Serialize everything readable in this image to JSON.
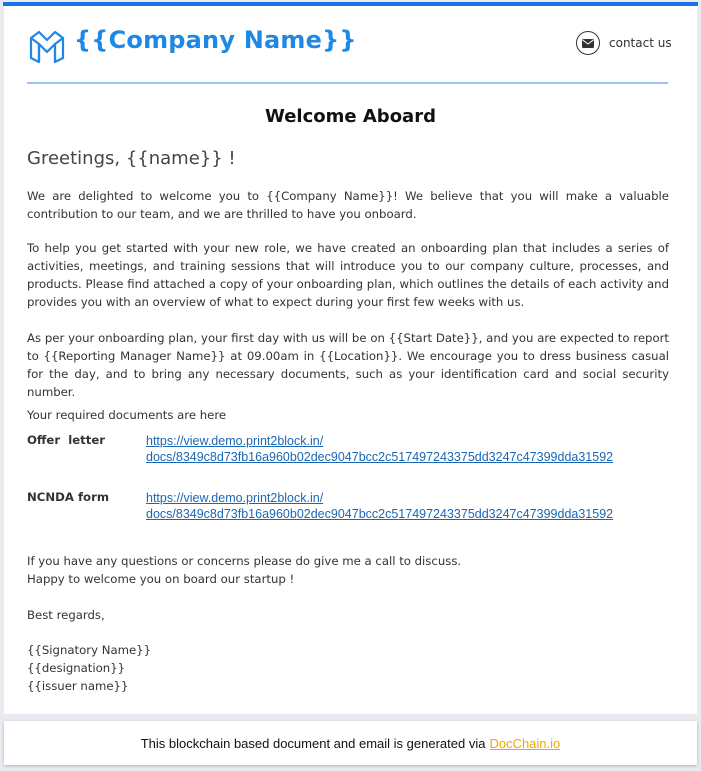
{
  "header": {
    "company_name": "{{Company Name}}",
    "contact_label": "contact us",
    "brand_color": "#1e88e5"
  },
  "title": "Welcome Aboard",
  "greeting": "Greetings,  {{name}} !",
  "body": {
    "p1": "We are delighted to welcome you to {{Company Name}}! We believe that you will make a valuable contribution to our team, and we are thrilled to have you onboard.",
    "p2": "To help you get started with your new role, we have created an onboarding plan that includes a series of activities, meetings, and training sessions that will introduce you to our company culture, processes, and products. Please find attached a copy of your onboarding plan, which outlines the details of each activity and provides you with an overview of what to expect during your first few weeks with us.",
    "p3": "As per your onboarding plan, your first day with us will be on {{Start Date}}, and you are expected to report to {{Reporting Manager Name}} at 09.00am in {{Location}}. We encourage you to dress business casual for the day, and to bring any necessary documents, such as your identification card and social security number."
  },
  "documents": {
    "intro": "Your required documents are here",
    "items": [
      {
        "label": "Offer  letter",
        "link_line1": "https://view.demo.print2block.in/",
        "link_line2": "docs/8349c8d73fb16a960b02dec9047bcc2c517497243375dd3247c47399dda31592"
      },
      {
        "label": "NCNDA form",
        "link_line1": "https://view.demo.print2block.in/",
        "link_line2": "docs/8349c8d73fb16a960b02dec9047bcc2c517497243375dd3247c47399dda31592"
      }
    ]
  },
  "closing": {
    "line1": "If you have any questions or concerns please do give me a call to discuss.",
    "line2": "Happy to welcome you on board our startup !",
    "regards": "Best regards,",
    "signatory": "{{Signatory Name}}",
    "designation": "{{designation}}",
    "issuer": "{{issuer name}}"
  },
  "footer": {
    "text": "This blockchain based document and email is generated via",
    "link_label": "DocChain.io",
    "link_color": "#f0a800"
  }
}
